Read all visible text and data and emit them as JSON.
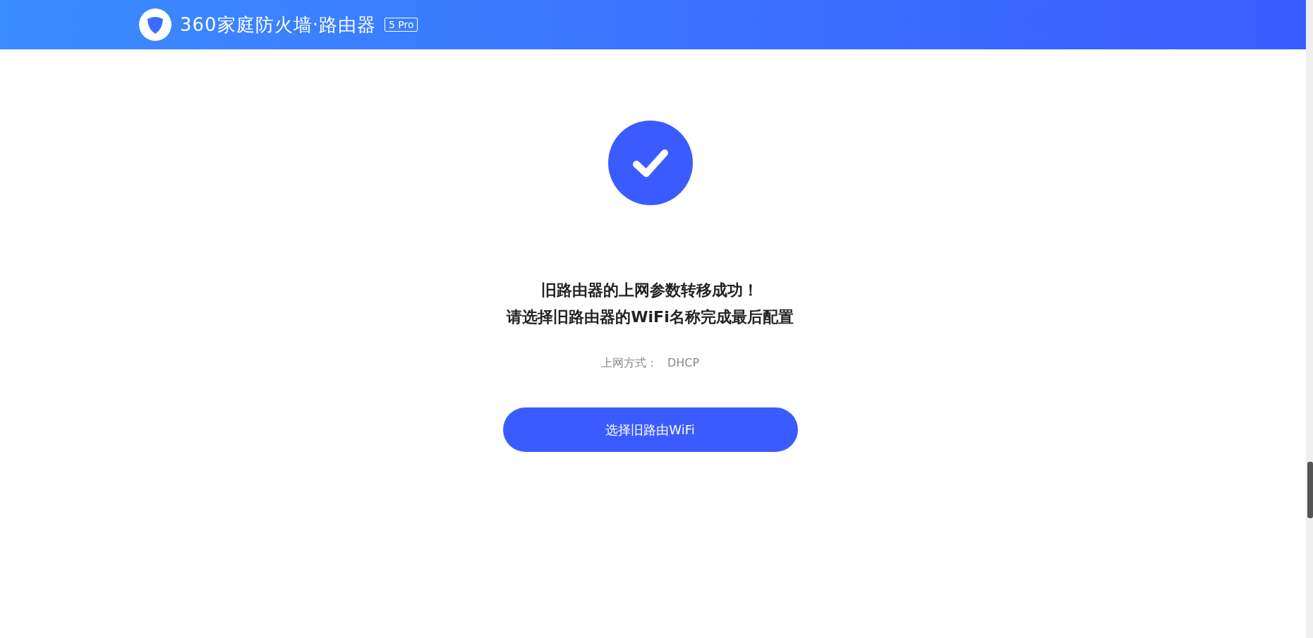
{
  "header": {
    "brand": "360家庭防火墙·路由器",
    "badge": "5 Pro"
  },
  "messages": [
    "旧路由器的上网参数转移成功！",
    "请选择旧路由器的WiFi名称完成最后配置"
  ],
  "connection": {
    "label": "上网方式：",
    "value": "DHCP"
  },
  "button": {
    "label": "选择旧路由WiFi"
  }
}
